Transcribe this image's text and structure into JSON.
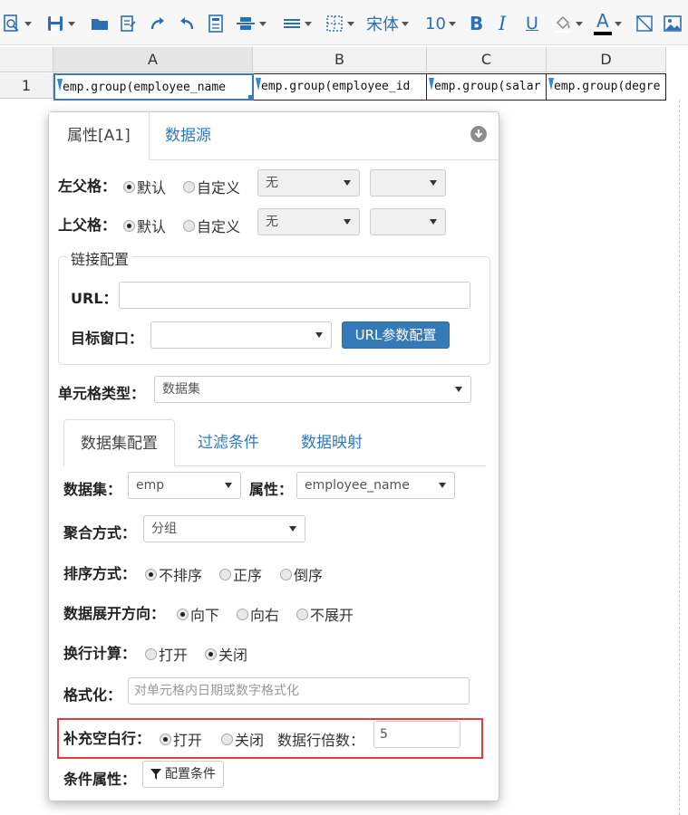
{
  "toolbar": {
    "font_name": "宋体",
    "font_size": "10"
  },
  "grid": {
    "columns": [
      "A",
      "B",
      "C",
      "D"
    ],
    "row_number": "1",
    "cells": [
      "emp.group(employee_name",
      "emp.group(employee_id",
      "emp.group(salar",
      "emp.group(degre"
    ]
  },
  "panel": {
    "tabs": [
      "属性[A1]",
      "数据源"
    ],
    "left_parent": {
      "label": "左父格：",
      "options": [
        "默认",
        "自定义"
      ],
      "selected": 0,
      "select_value": "无",
      "select2_value": ""
    },
    "top_parent": {
      "label": "上父格：",
      "options": [
        "默认",
        "自定义"
      ],
      "selected": 0,
      "select_value": "无",
      "select2_value": ""
    },
    "link": {
      "legend": "链接配置",
      "url_label": "URL：",
      "url_value": "",
      "target_label": "目标窗口：",
      "target_value": "",
      "url_param_button": "URL参数配置"
    },
    "cell_type": {
      "label": "单元格类型：",
      "value": "数据集"
    },
    "sub_tabs": [
      "数据集配置",
      "过滤条件",
      "数据映射"
    ],
    "dataset": {
      "label": "数据集：",
      "value": "emp",
      "attr_label": "属性：",
      "attr_value": "employee_name"
    },
    "aggregate": {
      "label": "聚合方式：",
      "value": "分组"
    },
    "sort": {
      "label": "排序方式：",
      "options": [
        "不排序",
        "正序",
        "倒序"
      ],
      "selected": 0
    },
    "expand": {
      "label": "数据展开方向：",
      "options": [
        "向下",
        "向右",
        "不展开"
      ],
      "selected": 0
    },
    "wrap_calc": {
      "label": "换行计算：",
      "options": [
        "打开",
        "关闭"
      ],
      "selected": 1
    },
    "format": {
      "label": "格式化：",
      "placeholder": "对单元格内日期或数字格式化"
    },
    "fill_blank": {
      "label": "补充空白行：",
      "options": [
        "打开",
        "关闭"
      ],
      "selected": 0,
      "multiple_label": "数据行倍数：",
      "multiple_value": "5"
    },
    "condition": {
      "label": "条件属性：",
      "button": "配置条件"
    }
  },
  "colors": {
    "accent": "#337ab7",
    "highlight_border": "#e03c3c",
    "toolbar_icon": "#2b6fb5"
  }
}
